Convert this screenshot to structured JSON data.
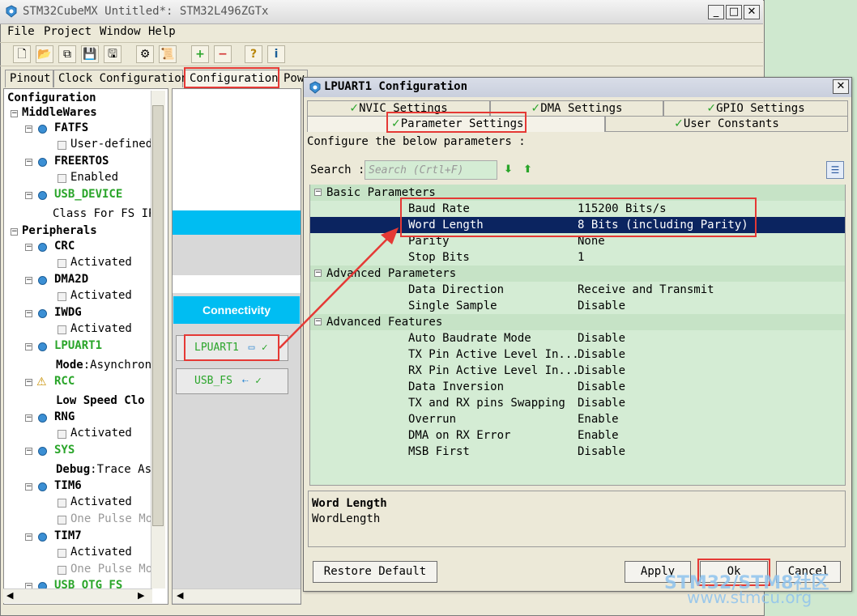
{
  "window": {
    "title": "STM32CubeMX Untitled*: STM32L496ZGTx",
    "minimize": "_",
    "maximize": "□",
    "close": "✕"
  },
  "menu": [
    "File",
    "Project",
    "Window",
    "Help"
  ],
  "tabs": [
    "Pinout",
    "Clock Configuration",
    "Configuration",
    "Pow"
  ],
  "tree": {
    "root": "Configuration",
    "middlewares": "MiddleWares",
    "fatfs": "FATFS",
    "fatfs_child": "User-defined",
    "freertos": "FREERTOS",
    "freertos_child": "Enabled",
    "usb_device": "USB_DEVICE",
    "usb_device_child": "Class For FS IP",
    "peripherals": "Peripherals",
    "crc": "CRC",
    "dma2d": "DMA2D",
    "iwdg": "IWDG",
    "activated": "Activated",
    "lpuart1": "LPUART1",
    "lpuart1_mode_label": "Mode",
    "lpuart1_mode_value": ":Asynchron",
    "rcc": "RCC",
    "rcc_child": "Low Speed Clo",
    "rng": "RNG",
    "sys": "SYS",
    "sys_debug_label": "Debug",
    "sys_debug_value": ":Trace As",
    "tim6": "TIM6",
    "tim7": "TIM7",
    "one_pulse": "One Pulse Mo",
    "usb_otg": "USB_OTG_FS"
  },
  "canvas": {
    "category": "Connectivity",
    "lpuart1": "LPUART1",
    "usb_fs": "USB_FS"
  },
  "dialog": {
    "title": "LPUART1 Configuration",
    "close": "✕",
    "tabs_row1": [
      "NVIC Settings",
      "DMA Settings",
      "GPIO Settings"
    ],
    "tabs_row2": [
      "Parameter Settings",
      "User Constants"
    ],
    "instruction": "Configure the below parameters :",
    "search_label": "Search :",
    "search_placeholder": "Search (Crtl+F)",
    "groups": {
      "basic": "Basic Parameters",
      "advanced": "Advanced Parameters",
      "features": "Advanced Features"
    },
    "basic_params": [
      {
        "name": "Baud Rate",
        "value": "115200 Bits/s"
      },
      {
        "name": "Word Length",
        "value": "8 Bits (including Parity)"
      },
      {
        "name": "Parity",
        "value": "None"
      },
      {
        "name": "Stop Bits",
        "value": "1"
      }
    ],
    "advanced_params": [
      {
        "name": "Data Direction",
        "value": "Receive and Transmit"
      },
      {
        "name": "Single Sample",
        "value": "Disable"
      }
    ],
    "advanced_features": [
      {
        "name": "Auto Baudrate Mode",
        "value": "Disable"
      },
      {
        "name": "TX Pin Active Level In...",
        "value": "Disable"
      },
      {
        "name": "RX Pin Active Level In...",
        "value": "Disable"
      },
      {
        "name": "Data Inversion",
        "value": "Disable"
      },
      {
        "name": "TX and RX pins Swapping",
        "value": "Disable"
      },
      {
        "name": "Overrun",
        "value": "Enable"
      },
      {
        "name": "DMA on RX Error",
        "value": "Enable"
      },
      {
        "name": "MSB First",
        "value": "Disable"
      }
    ],
    "description_title": "Word Length",
    "description_sub": "WordLength",
    "buttons": {
      "restore": "Restore Default",
      "apply": "Apply",
      "ok": "Ok",
      "cancel": "Cancel"
    }
  },
  "watermark": {
    "line1": "STM32/STM8社区",
    "line2": "www.stmcu.org"
  },
  "colors": {
    "selection": "#0b2460",
    "highlight": "#e53935",
    "accent_green": "#2aa52a",
    "connectivity": "#00bdf2"
  }
}
